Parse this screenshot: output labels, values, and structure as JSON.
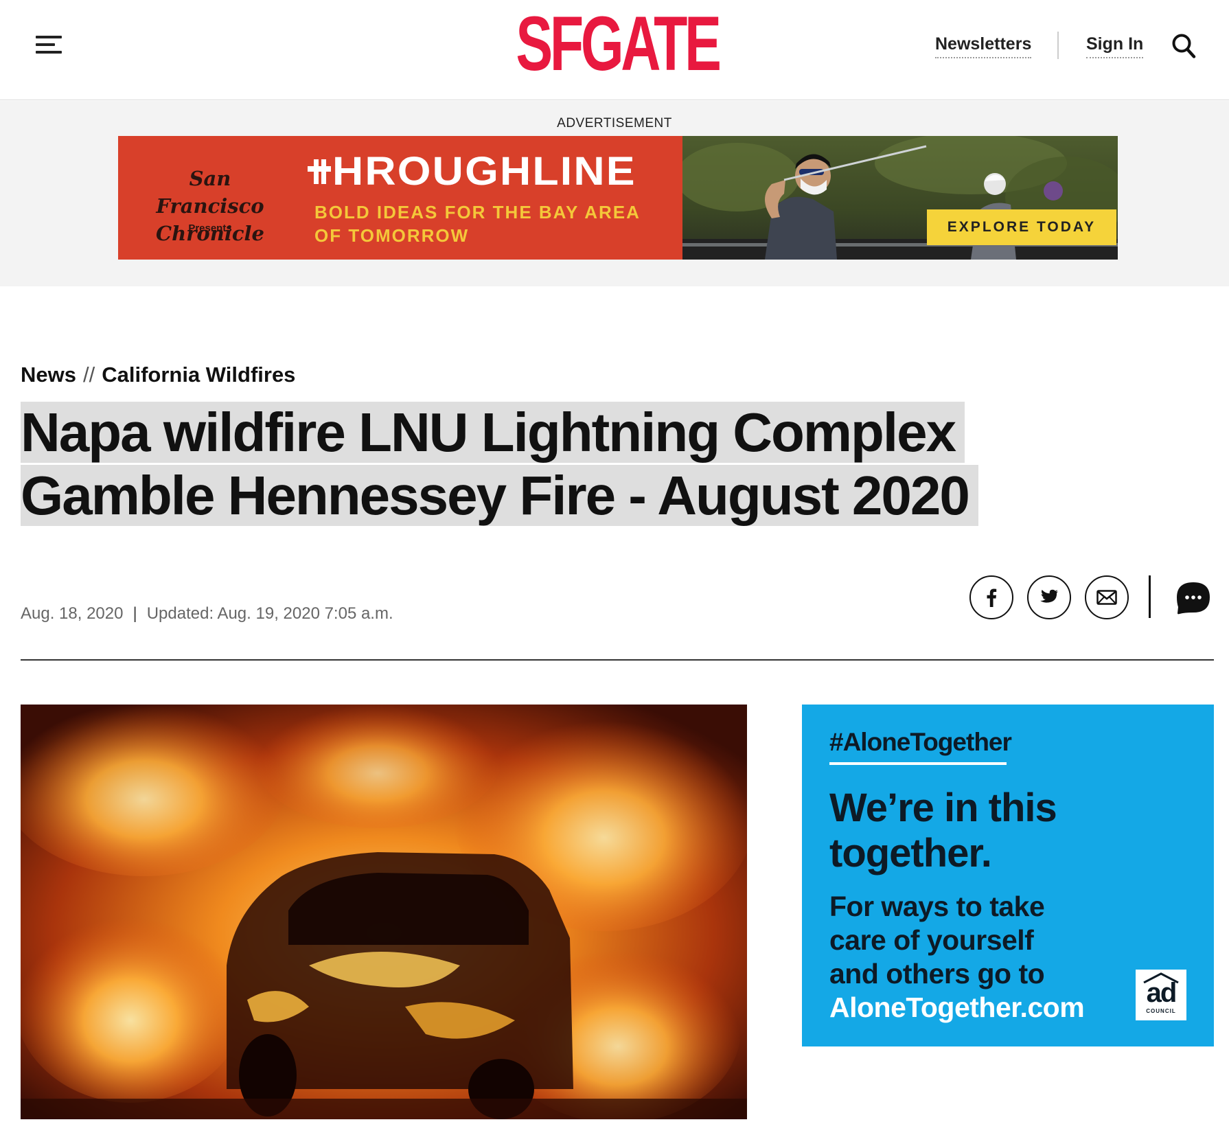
{
  "header": {
    "logo": "SFGATE",
    "newsletters_label": "Newsletters",
    "signin_label": "Sign In"
  },
  "ad_band": {
    "label": "ADVERTISEMENT",
    "banner": {
      "presenter_line1": "San Francisco",
      "presenter_line2": "Chronicle",
      "presents": "Presents",
      "title": "HROUGHLINE",
      "tagline_line1": "BOLD IDEAS FOR THE BAY AREA",
      "tagline_line2": "OF TOMORROW",
      "cta": "EXPLORE TODAY"
    }
  },
  "breadcrumb": {
    "section": "News",
    "separator": "//",
    "topic": "California Wildfires"
  },
  "article": {
    "headline": "Napa wildfire LNU Lightning Complex Gamble Hennessey Fire - August 2020",
    "published": "Aug. 18, 2020",
    "separator": "|",
    "updated": "Updated: Aug. 19, 2020 7:05 a.m."
  },
  "share": {
    "icons": [
      "facebook-icon",
      "twitter-icon",
      "mail-icon",
      "comment-icon"
    ]
  },
  "side_ad": {
    "hashtag": "#AloneTogether",
    "headline_line1": "We’re in this",
    "headline_line2": "together.",
    "body_line1": "For ways to take",
    "body_line2": "care of yourself",
    "body_line3": "and others go to",
    "url": "AloneTogether.com",
    "badge_main": "ad",
    "badge_sub": "COUNCIL"
  },
  "colors": {
    "brand": "#e8193f",
    "banner_red": "#d8402a",
    "banner_yellow": "#f5d33a",
    "side_ad_blue": "#14a8e6",
    "headline_highlight": "#dedede"
  }
}
